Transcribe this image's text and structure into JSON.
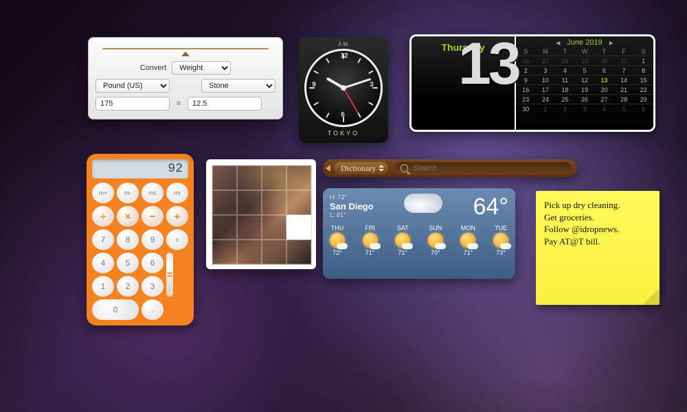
{
  "converter": {
    "convert_label": "Convert",
    "category": "Weight",
    "from_unit": "Pound (US)",
    "to_unit": "Stone",
    "from_value": "175",
    "eq": "=",
    "to_value": "12.5"
  },
  "clock": {
    "ampm": "AM",
    "city": "TOKYO",
    "hour_angle": 300,
    "minute_angle": 72,
    "second_angle": 150
  },
  "calendar": {
    "day_name": "Thursday",
    "day_num": "13",
    "month_label": "June 2019",
    "dow": [
      "S",
      "M",
      "T",
      "W",
      "T",
      "F",
      "S"
    ],
    "weeks": [
      [
        {
          "n": "26",
          "dim": true
        },
        {
          "n": "27",
          "dim": true
        },
        {
          "n": "28",
          "dim": true
        },
        {
          "n": "29",
          "dim": true
        },
        {
          "n": "30",
          "dim": true
        },
        {
          "n": "31",
          "dim": true
        },
        {
          "n": "1"
        }
      ],
      [
        {
          "n": "2"
        },
        {
          "n": "3"
        },
        {
          "n": "4"
        },
        {
          "n": "5"
        },
        {
          "n": "6"
        },
        {
          "n": "7"
        },
        {
          "n": "8"
        }
      ],
      [
        {
          "n": "9"
        },
        {
          "n": "10"
        },
        {
          "n": "11"
        },
        {
          "n": "12"
        },
        {
          "n": "13",
          "today": true
        },
        {
          "n": "14"
        },
        {
          "n": "15"
        }
      ],
      [
        {
          "n": "16"
        },
        {
          "n": "17"
        },
        {
          "n": "18"
        },
        {
          "n": "19"
        },
        {
          "n": "20"
        },
        {
          "n": "21"
        },
        {
          "n": "22"
        }
      ],
      [
        {
          "n": "23"
        },
        {
          "n": "24"
        },
        {
          "n": "25"
        },
        {
          "n": "26"
        },
        {
          "n": "27"
        },
        {
          "n": "28"
        },
        {
          "n": "29"
        }
      ],
      [
        {
          "n": "30"
        },
        {
          "n": "1",
          "dim": true
        },
        {
          "n": "2",
          "dim": true
        },
        {
          "n": "3",
          "dim": true
        },
        {
          "n": "4",
          "dim": true
        },
        {
          "n": "5",
          "dim": true
        },
        {
          "n": "6",
          "dim": true
        }
      ]
    ]
  },
  "calculator": {
    "display": "92",
    "keys": [
      {
        "l": "m+",
        "c": "small"
      },
      {
        "l": "m-",
        "c": "small"
      },
      {
        "l": "mc",
        "c": "small"
      },
      {
        "l": "mr",
        "c": "small"
      },
      {
        "l": "÷",
        "c": "op"
      },
      {
        "l": "×",
        "c": "op"
      },
      {
        "l": "−",
        "c": "op"
      },
      {
        "l": "+",
        "c": "op"
      },
      {
        "l": "7"
      },
      {
        "l": "8"
      },
      {
        "l": "9"
      },
      {
        "l": "c",
        "c": "small"
      },
      {
        "l": "4"
      },
      {
        "l": "5"
      },
      {
        "l": "6"
      },
      {
        "l": "=",
        "c": "op eq"
      },
      {
        "l": "1"
      },
      {
        "l": "2"
      },
      {
        "l": "3"
      },
      {
        "l": "0",
        "c": "z"
      },
      {
        "l": "."
      }
    ]
  },
  "puzzle": {
    "empty_index": 11
  },
  "dictionary": {
    "mode": "Dictionary",
    "placeholder": "Search"
  },
  "weather": {
    "location": "San Diego",
    "hi": "H: 72°",
    "lo": "L: 61°",
    "temp": "64°",
    "forecast": [
      {
        "d": "THU",
        "t": "72°"
      },
      {
        "d": "FRI",
        "t": "71°"
      },
      {
        "d": "SAT",
        "t": "71°"
      },
      {
        "d": "SUN",
        "t": "70°"
      },
      {
        "d": "MON",
        "t": "71°"
      },
      {
        "d": "TUE",
        "t": "73°"
      }
    ]
  },
  "sticky": {
    "lines": [
      "Pick up dry cleaning.",
      "Get groceries.",
      "Follow @idropnews.",
      "Pay AT@T bill."
    ]
  }
}
